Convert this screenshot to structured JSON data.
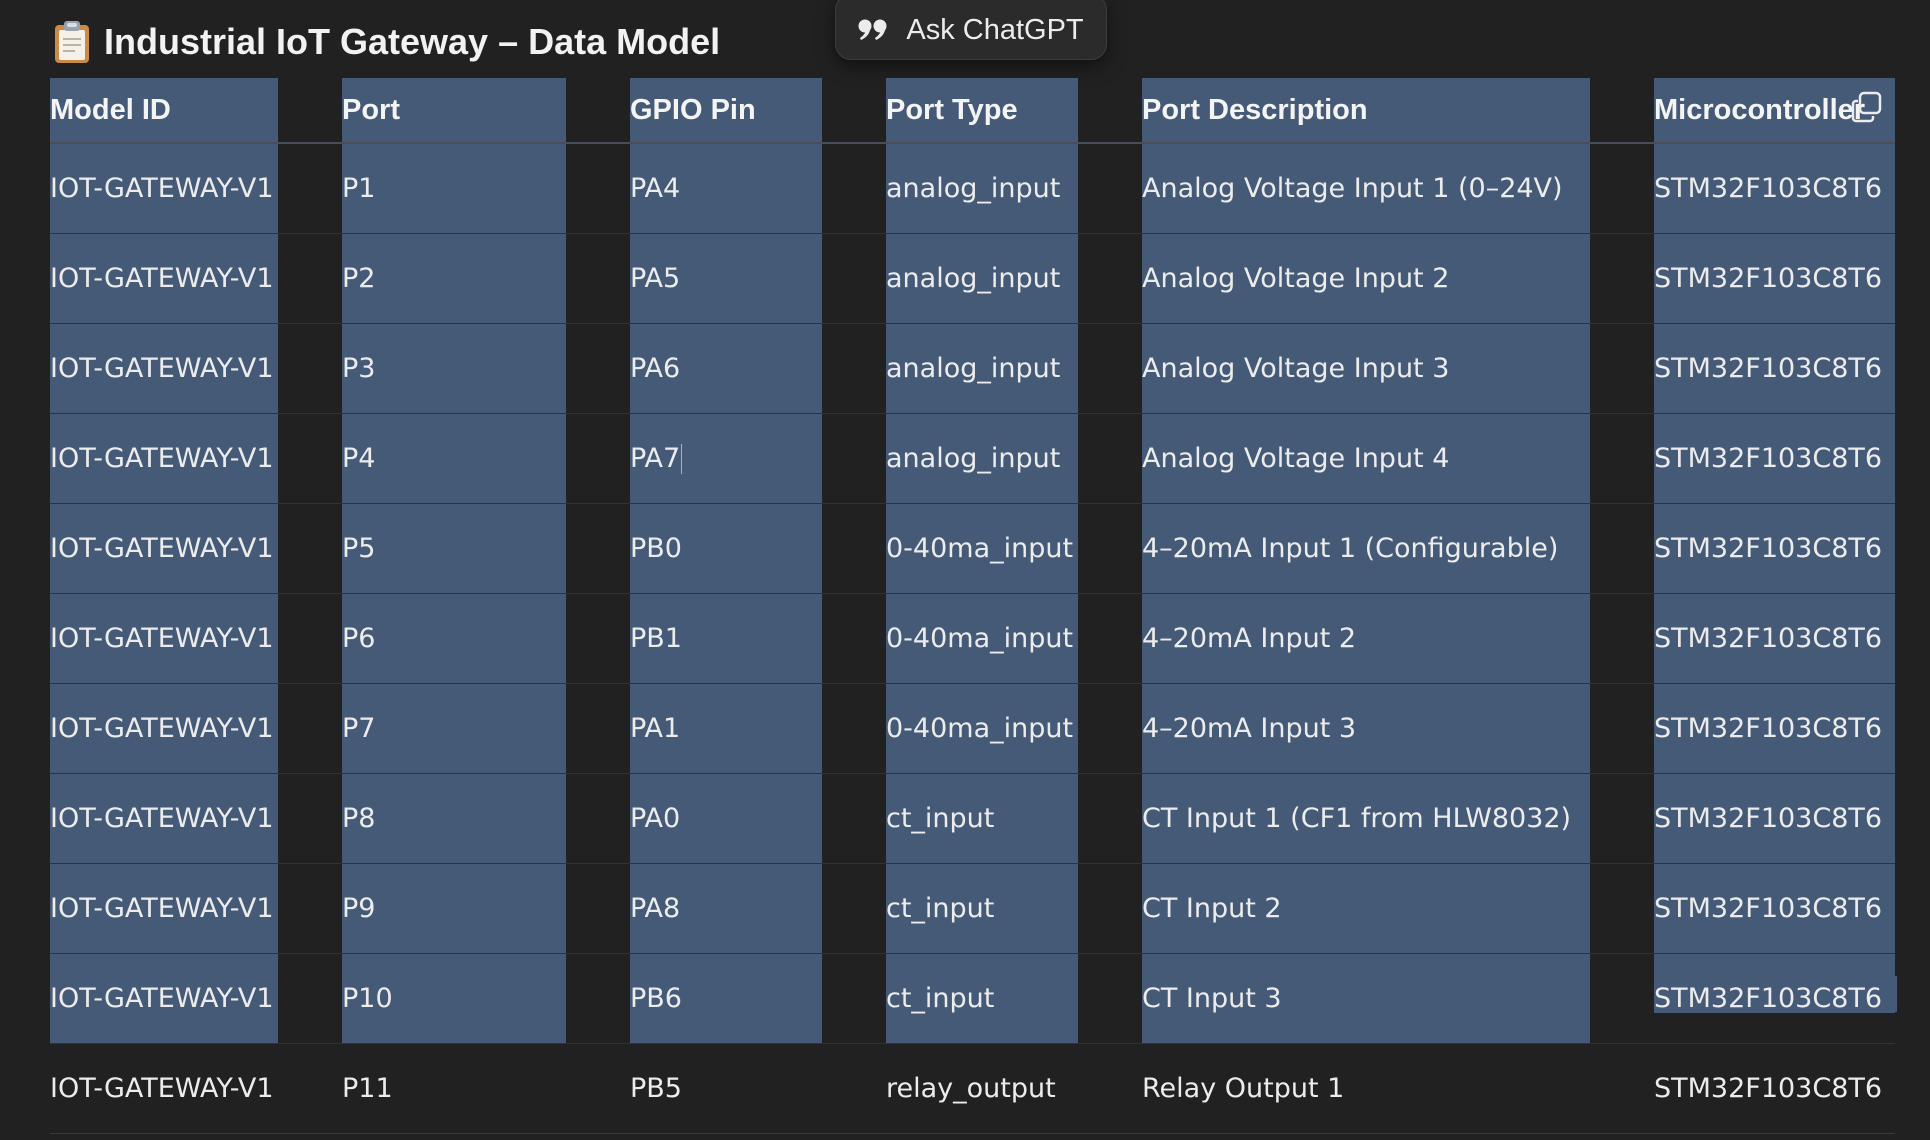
{
  "title": {
    "emoji": "📋",
    "text": "Industrial IoT Gateway – Data Model"
  },
  "ask_popover": {
    "label": "Ask ChatGPT",
    "icon": "quote-icon"
  },
  "table": {
    "copy_icon": "copy-icon",
    "columns": [
      "Model ID",
      "Port",
      "GPIO Pin",
      "Port Type",
      "Port Description",
      "Microcontroller"
    ],
    "rows": [
      [
        "IOT-GATEWAY-V1",
        "P1",
        "PA4",
        "analog_input",
        "Analog Voltage Input 1 (0–24V)",
        "STM32F103C8T6"
      ],
      [
        "IOT-GATEWAY-V1",
        "P2",
        "PA5",
        "analog_input",
        "Analog Voltage Input 2",
        "STM32F103C8T6"
      ],
      [
        "IOT-GATEWAY-V1",
        "P3",
        "PA6",
        "analog_input",
        "Analog Voltage Input 3",
        "STM32F103C8T6"
      ],
      [
        "IOT-GATEWAY-V1",
        "P4",
        "PA7",
        "analog_input",
        "Analog Voltage Input 4",
        "STM32F103C8T6"
      ],
      [
        "IOT-GATEWAY-V1",
        "P5",
        "PB0",
        "0-40ma_input",
        "4–20mA Input 1 (Configurable)",
        "STM32F103C8T6"
      ],
      [
        "IOT-GATEWAY-V1",
        "P6",
        "PB1",
        "0-40ma_input",
        "4–20mA Input 2",
        "STM32F103C8T6"
      ],
      [
        "IOT-GATEWAY-V1",
        "P7",
        "PA1",
        "0-40ma_input",
        "4–20mA Input 3",
        "STM32F103C8T6"
      ],
      [
        "IOT-GATEWAY-V1",
        "P8",
        "PA0",
        "ct_input",
        "CT Input 1 (CF1 from HLW8032)",
        "STM32F103C8T6"
      ],
      [
        "IOT-GATEWAY-V1",
        "P9",
        "PA8",
        "ct_input",
        "CT Input 2",
        "STM32F103C8T6"
      ],
      [
        "IOT-GATEWAY-V1",
        "P10",
        "PB6",
        "ct_input",
        "CT Input 3",
        "STM32F103C8T6"
      ],
      [
        "IOT-GATEWAY-V1",
        "P11",
        "PB5",
        "relay_output",
        "Relay Output 1",
        "STM32F103C8T6"
      ]
    ]
  },
  "colors": {
    "background": "#212121",
    "selection": "#455a77",
    "text": "#ececec"
  }
}
